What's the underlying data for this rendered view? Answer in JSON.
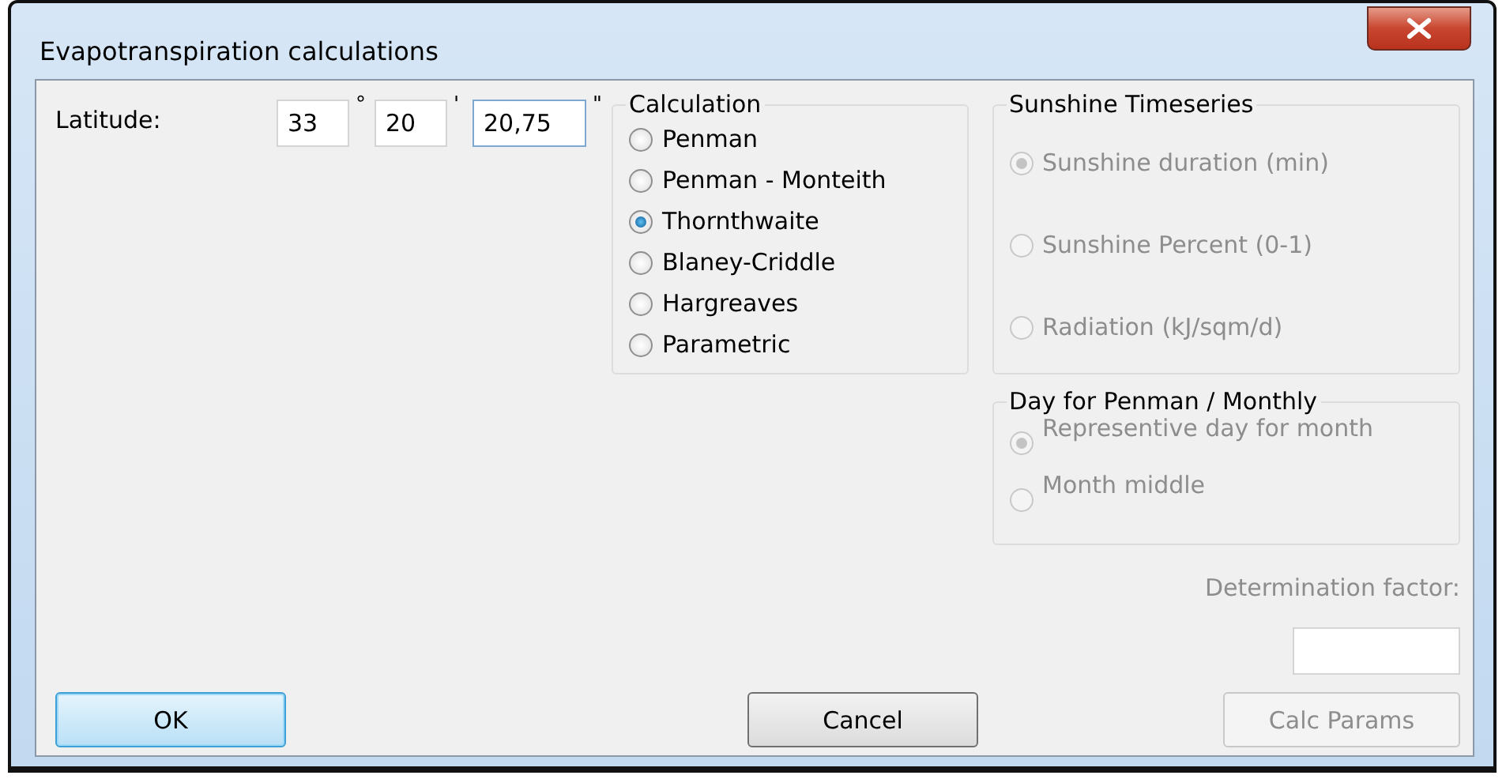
{
  "window": {
    "title": "Evapotranspiration calculations"
  },
  "latitude": {
    "label": "Latitude:",
    "parts": [
      {
        "value": "33",
        "unit": "°",
        "focused": false
      },
      {
        "value": "20",
        "unit": "'",
        "focused": false
      },
      {
        "value": "20,75",
        "unit": "\"",
        "focused": true
      }
    ]
  },
  "calculation": {
    "title": "Calculation",
    "options": [
      {
        "label": "Penman",
        "selected": false,
        "disabled": false
      },
      {
        "label": "Penman - Monteith",
        "selected": false,
        "disabled": false
      },
      {
        "label": "Thornthwaite",
        "selected": true,
        "disabled": false
      },
      {
        "label": "Blaney-Criddle",
        "selected": false,
        "disabled": false
      },
      {
        "label": "Hargreaves",
        "selected": false,
        "disabled": false
      },
      {
        "label": "Parametric",
        "selected": false,
        "disabled": false
      }
    ]
  },
  "sunshine_timeseries": {
    "title": "Sunshine Timeseries",
    "options": [
      {
        "label": "Sunshine duration (min)",
        "selected": true,
        "disabled": true
      },
      {
        "label": "Sunshine Percent (0-1)",
        "selected": false,
        "disabled": true
      },
      {
        "label": "Radiation (kJ/sqm/d)",
        "selected": false,
        "disabled": true
      }
    ]
  },
  "day_for_penman": {
    "title": "Day for Penman / Monthly",
    "options": [
      {
        "label": "Representive day for month",
        "selected": true,
        "disabled": true
      },
      {
        "label": "Month middle",
        "selected": false,
        "disabled": true
      }
    ]
  },
  "determination_factor": {
    "label": "Determination factor:",
    "disabled": true
  },
  "buttons": [
    {
      "label": "OK",
      "default": true,
      "disabled": false
    },
    {
      "label": "Cancel",
      "default": false,
      "disabled": false
    },
    {
      "label": "Calc Params",
      "default": false,
      "disabled": true
    }
  ]
}
